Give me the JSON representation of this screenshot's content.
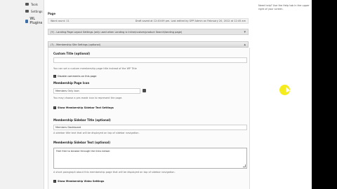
{
  "sidebar": {
    "items": [
      {
        "label": "Tools",
        "icon": "tools-icon"
      },
      {
        "label": "Settings",
        "icon": "settings-icon"
      },
      {
        "label": "WL Plugins",
        "icon": "plugin-icon"
      }
    ]
  },
  "main": {
    "page_label": "Page",
    "word_count": "Word count: 11",
    "last_edited": "Draft saved at 12:40:09 pm. Last edited by GPP Admin on February 20, 2012 at 12:45 am",
    "permalink": "(Y) - Landing Page Layout Settings (only used when Landing is Inline/custom/product Search/landing page)",
    "panel_title": "(?) - Membership Site Settings (optional)"
  },
  "form": {
    "custom_title_label": "Custom Title (optional)",
    "custom_title_value": "",
    "custom_title_hint": "You can set a custom membership page title instead of the WP Title",
    "disable_comments_label": "Disable comments on this page",
    "icon_label": "Membership Page Icon",
    "icon_value": "Members Only Icon",
    "icon_hint": "You may choose a pre-made icon to represent the page.",
    "show_sidebar_text_label": "Show Membership Sidebar Text Settings",
    "sidebar_title_label": "Membership Sidebar Title (optional)",
    "sidebar_title_value": "Members Dashboard",
    "sidebar_title_hint": "A sidebar title text that will be displayed on top of sidebar navigation.",
    "sidebar_text_label": "Membership Sidebar Text (optional)",
    "sidebar_text_value": "Feel free to browse through the links below:",
    "sidebar_text_hint": "A short paragraph about this membership page that will be displayed on top of sidebar navigation.",
    "show_video_label": "Show Membership Video Settings"
  },
  "help": {
    "text": "Need help? Use the Help tab in the upper right of your screen."
  },
  "colors": {
    "sidebar_bg": "#f1f1f1",
    "panel_header": "#dcdcdc",
    "cursor_highlight": "#f4ec1e"
  }
}
